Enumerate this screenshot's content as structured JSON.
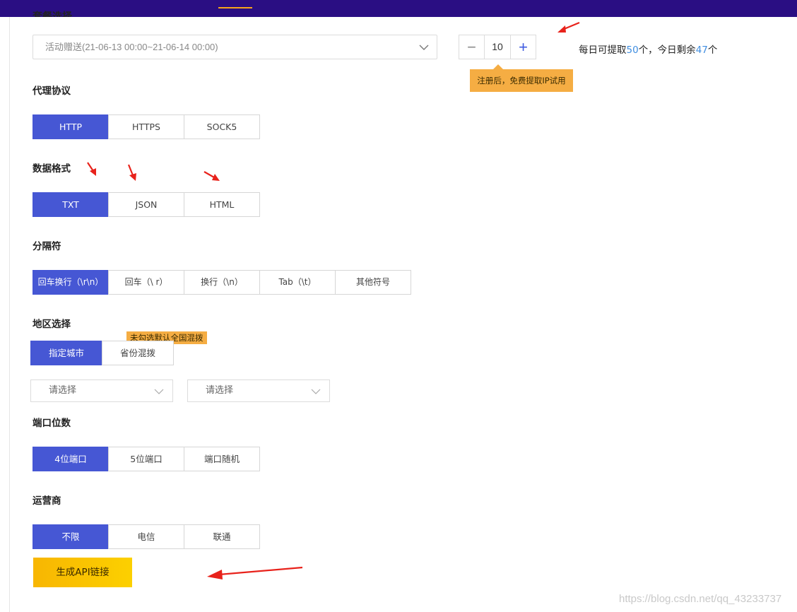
{
  "header": {
    "active_tab_indicator": true
  },
  "top_heading_partial": "套餐选择",
  "package": {
    "selected": "活动赠送(21-06-13 00:00~21-06-14 00:00)"
  },
  "quantity": {
    "minus": "−",
    "value": "10",
    "plus": "+"
  },
  "quota": {
    "prefix": "每日可提取",
    "daily": "50",
    "mid": "个，今日剩余",
    "remaining": "47",
    "suffix": "个"
  },
  "register_tip": "注册后，免费提取IP试用",
  "protocol": {
    "title": "代理协议",
    "options": [
      "HTTP",
      "HTTPS",
      "SOCK5"
    ],
    "selected": "HTTP"
  },
  "format": {
    "title": "数据格式",
    "options": [
      "TXT",
      "JSON",
      "HTML"
    ],
    "selected": "TXT"
  },
  "separator": {
    "title": "分隔符",
    "options": [
      "回车换行（\\r\\n）",
      "回车（\\ r）",
      "换行（\\n）",
      "Tab（\\t）",
      "其他符号"
    ],
    "selected": "回车换行（\\r\\n）"
  },
  "region": {
    "title": "地区选择",
    "options": [
      "指定城市",
      "省份混拨"
    ],
    "selected": "指定城市",
    "tip": "未勾选默认全国混拨",
    "province_placeholder": "请选择",
    "city_placeholder": "请选择"
  },
  "port": {
    "title": "端口位数",
    "options": [
      "4位端口",
      "5位端口",
      "端口随机"
    ],
    "selected": "4位端口"
  },
  "carrier": {
    "title": "运营商",
    "options": [
      "不限",
      "电信",
      "联通"
    ],
    "selected": "不限"
  },
  "generate_button": "生成API链接",
  "watermark": "https://blog.csdn.net/qq_43233737",
  "colors": {
    "topbar": "#2a0e83",
    "selected_option": "#4657d4",
    "tip": "#f5ad43",
    "generate": "#f8b602",
    "annotation_arrow": "#e8221b"
  }
}
